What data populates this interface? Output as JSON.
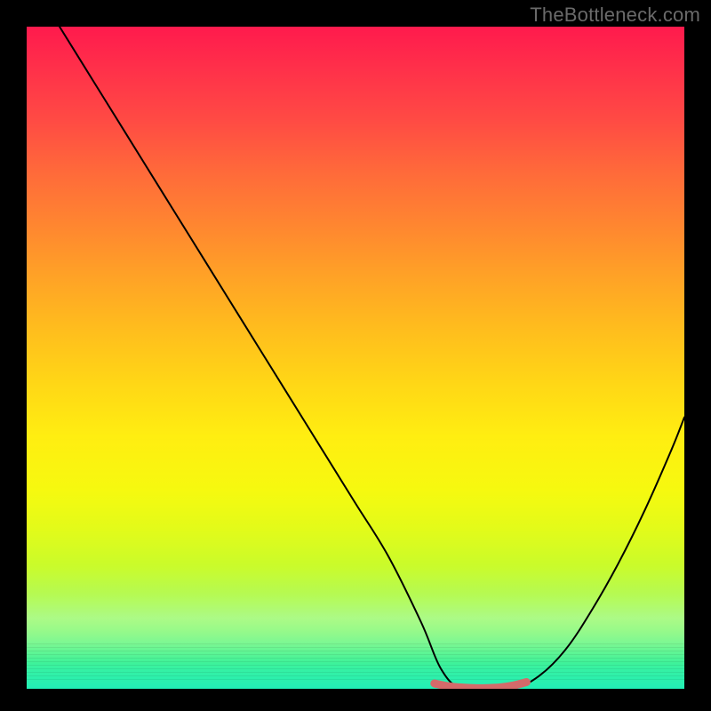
{
  "watermark": "TheBottleneck.com",
  "chart_data": {
    "type": "line",
    "title": "",
    "xlabel": "",
    "ylabel": "",
    "xlim": [
      0,
      100
    ],
    "ylim": [
      0,
      100
    ],
    "series": [
      {
        "name": "bottleneck-curve",
        "x": [
          5,
          10,
          15,
          20,
          25,
          30,
          35,
          40,
          45,
          50,
          55,
          60,
          63,
          66,
          70,
          74,
          78,
          82,
          86,
          90,
          94,
          98,
          100
        ],
        "values": [
          100,
          92,
          84,
          76,
          68,
          60,
          52,
          44,
          36,
          28,
          20,
          10,
          3,
          0,
          0,
          0,
          2,
          6,
          12,
          19,
          27,
          36,
          41
        ]
      },
      {
        "name": "optimal-band",
        "x": [
          62,
          64,
          66,
          68,
          70,
          72,
          74,
          76
        ],
        "values": [
          0.8,
          0.4,
          0.2,
          0.1,
          0.1,
          0.2,
          0.5,
          1.0
        ]
      }
    ],
    "colors": {
      "curve": "#000000",
      "optimal_band": "#d46a6a"
    },
    "annotations": []
  }
}
